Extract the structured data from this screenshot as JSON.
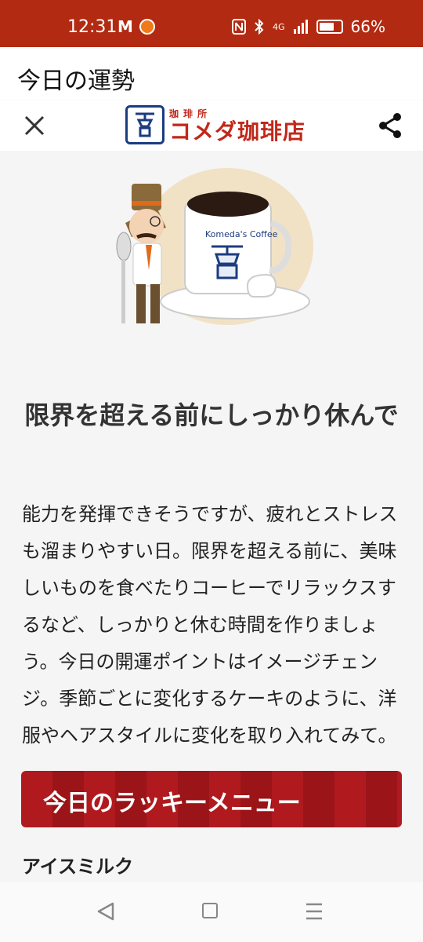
{
  "status_bar": {
    "time": "12:31",
    "mail_icon": "M",
    "battery_pct": "66%",
    "network": "4G"
  },
  "header": {
    "title": "今日の運勢"
  },
  "app_header": {
    "logo_small": "珈琲所",
    "logo_main": "コメダ珈琲店",
    "close_icon": "close-icon",
    "share_icon": "share-icon"
  },
  "illustration": {
    "mug_text": "Komeda's Coffee"
  },
  "fortune": {
    "heading": "限界を超える前にしっかり休んで",
    "body": "能力を発揮できそうですが、疲れとストレスも溜まりやすい日。限界を超える前に、美味しいものを食べたりコーヒーでリラックスするなど、しっかりと休む時間を作りましょう。今日の開運ポイントはイメージチェンジ。季節ごとに変化するケーキのように、洋服やヘアスタイルに変化を取り入れてみて。"
  },
  "lucky": {
    "title": "今日のラッキーメニュー",
    "item": "アイスミルク"
  },
  "colors": {
    "status_bar": "#b32a12",
    "brand_red": "#c0281a",
    "brand_blue": "#1c3c80",
    "banner_red": "#b01a1e"
  }
}
